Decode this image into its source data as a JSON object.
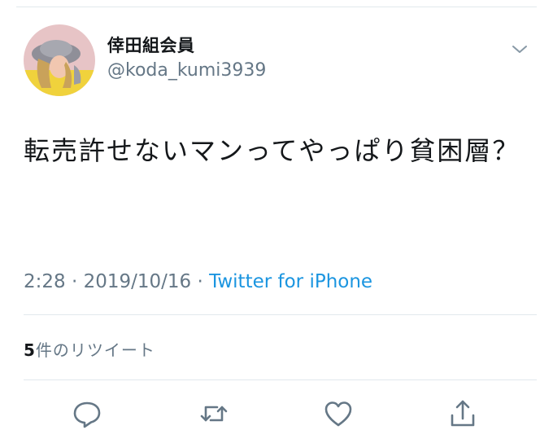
{
  "tweet": {
    "display_name": "倖田組会員",
    "handle": "@koda_kumi3939",
    "text": "転売許せないマンってやっぱり貧困層？",
    "time": "2:28",
    "date": "2019/10/16",
    "separator": "·",
    "source": "Twitter for iPhone"
  },
  "engagement": {
    "retweet_count": "5",
    "retweet_label": "件のリツイート"
  },
  "actions": {
    "reply_icon": "reply-bubble-icon",
    "retweet_icon": "retweet-arrows-icon",
    "like_icon": "heart-icon",
    "share_icon": "share-up-arrow-icon"
  },
  "colors": {
    "text_primary": "#14171a",
    "text_secondary": "#657786",
    "link": "#1b95e0",
    "divider": "#e1e8ed"
  }
}
